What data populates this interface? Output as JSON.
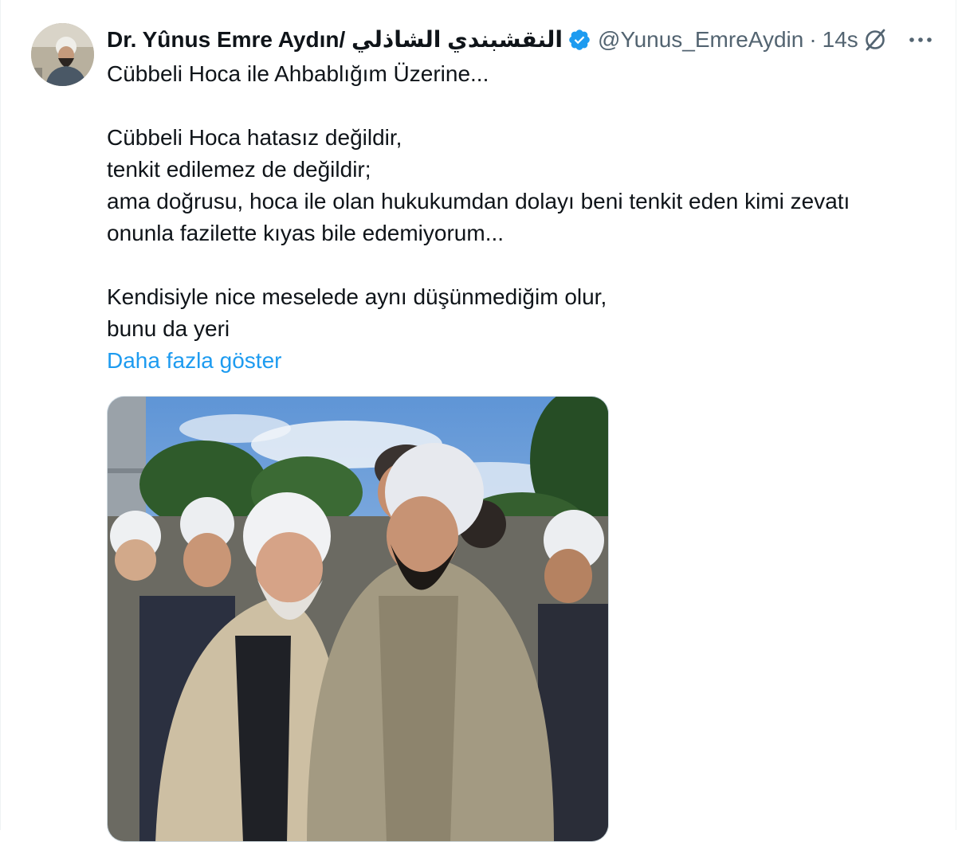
{
  "tweet": {
    "display_name": "النقشبندي الشاذلي /Dr. Yûnus Emre Aydın",
    "handle": "@Yunus_EmreAydin",
    "separator": "·",
    "time": "14s",
    "verified": true,
    "body_lines": [
      "Cübbeli Hoca ile Ahbablığım Üzerine...",
      "",
      "Cübbeli Hoca hatasız değildir,",
      "tenkit edilemez de değildir;",
      "ama doğrusu, hoca ile olan hukukumdan dolayı beni tenkit eden kimi zevatı",
      "onunla fazilette kıyas bile edemiyorum...",
      "",
      "Kendisiyle nice meselede aynı düşünmediğim olur,",
      "bunu da yeri"
    ],
    "show_more": "Daha fazla göster"
  },
  "icons": {
    "verified": "verified-badge-icon",
    "grok": "grok-icon",
    "more": "more-options-icon"
  },
  "colors": {
    "text": "#0f1419",
    "secondary": "#536471",
    "link": "#1d9bf0",
    "border": "#cfd9de"
  }
}
